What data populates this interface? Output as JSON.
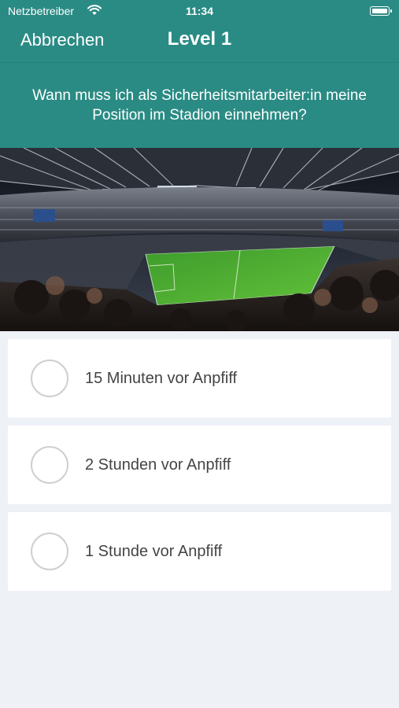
{
  "status_bar": {
    "carrier": "Netzbetreiber",
    "time": "11:34",
    "wifi_icon": "wifi-icon",
    "battery_icon": "battery-icon"
  },
  "nav": {
    "cancel_label": "Abbrechen",
    "title": "Level 1"
  },
  "question": {
    "text": "Wann muss ich als Sicherheitsmitarbeiter:in meine Position im Stadion einnehmen?"
  },
  "image": {
    "subject": "football stadium photo"
  },
  "answers": [
    {
      "label": "15 Minuten vor Anpfiff",
      "selected": false
    },
    {
      "label": "2 Stunden vor Anpfiff",
      "selected": false
    },
    {
      "label": "1 Stunde vor Anpfiff",
      "selected": false
    }
  ],
  "colors": {
    "header": "#2a8b84",
    "background": "#eef1f6",
    "card": "#ffffff",
    "radio_border": "#cfcfcf",
    "answer_text": "#444444"
  }
}
